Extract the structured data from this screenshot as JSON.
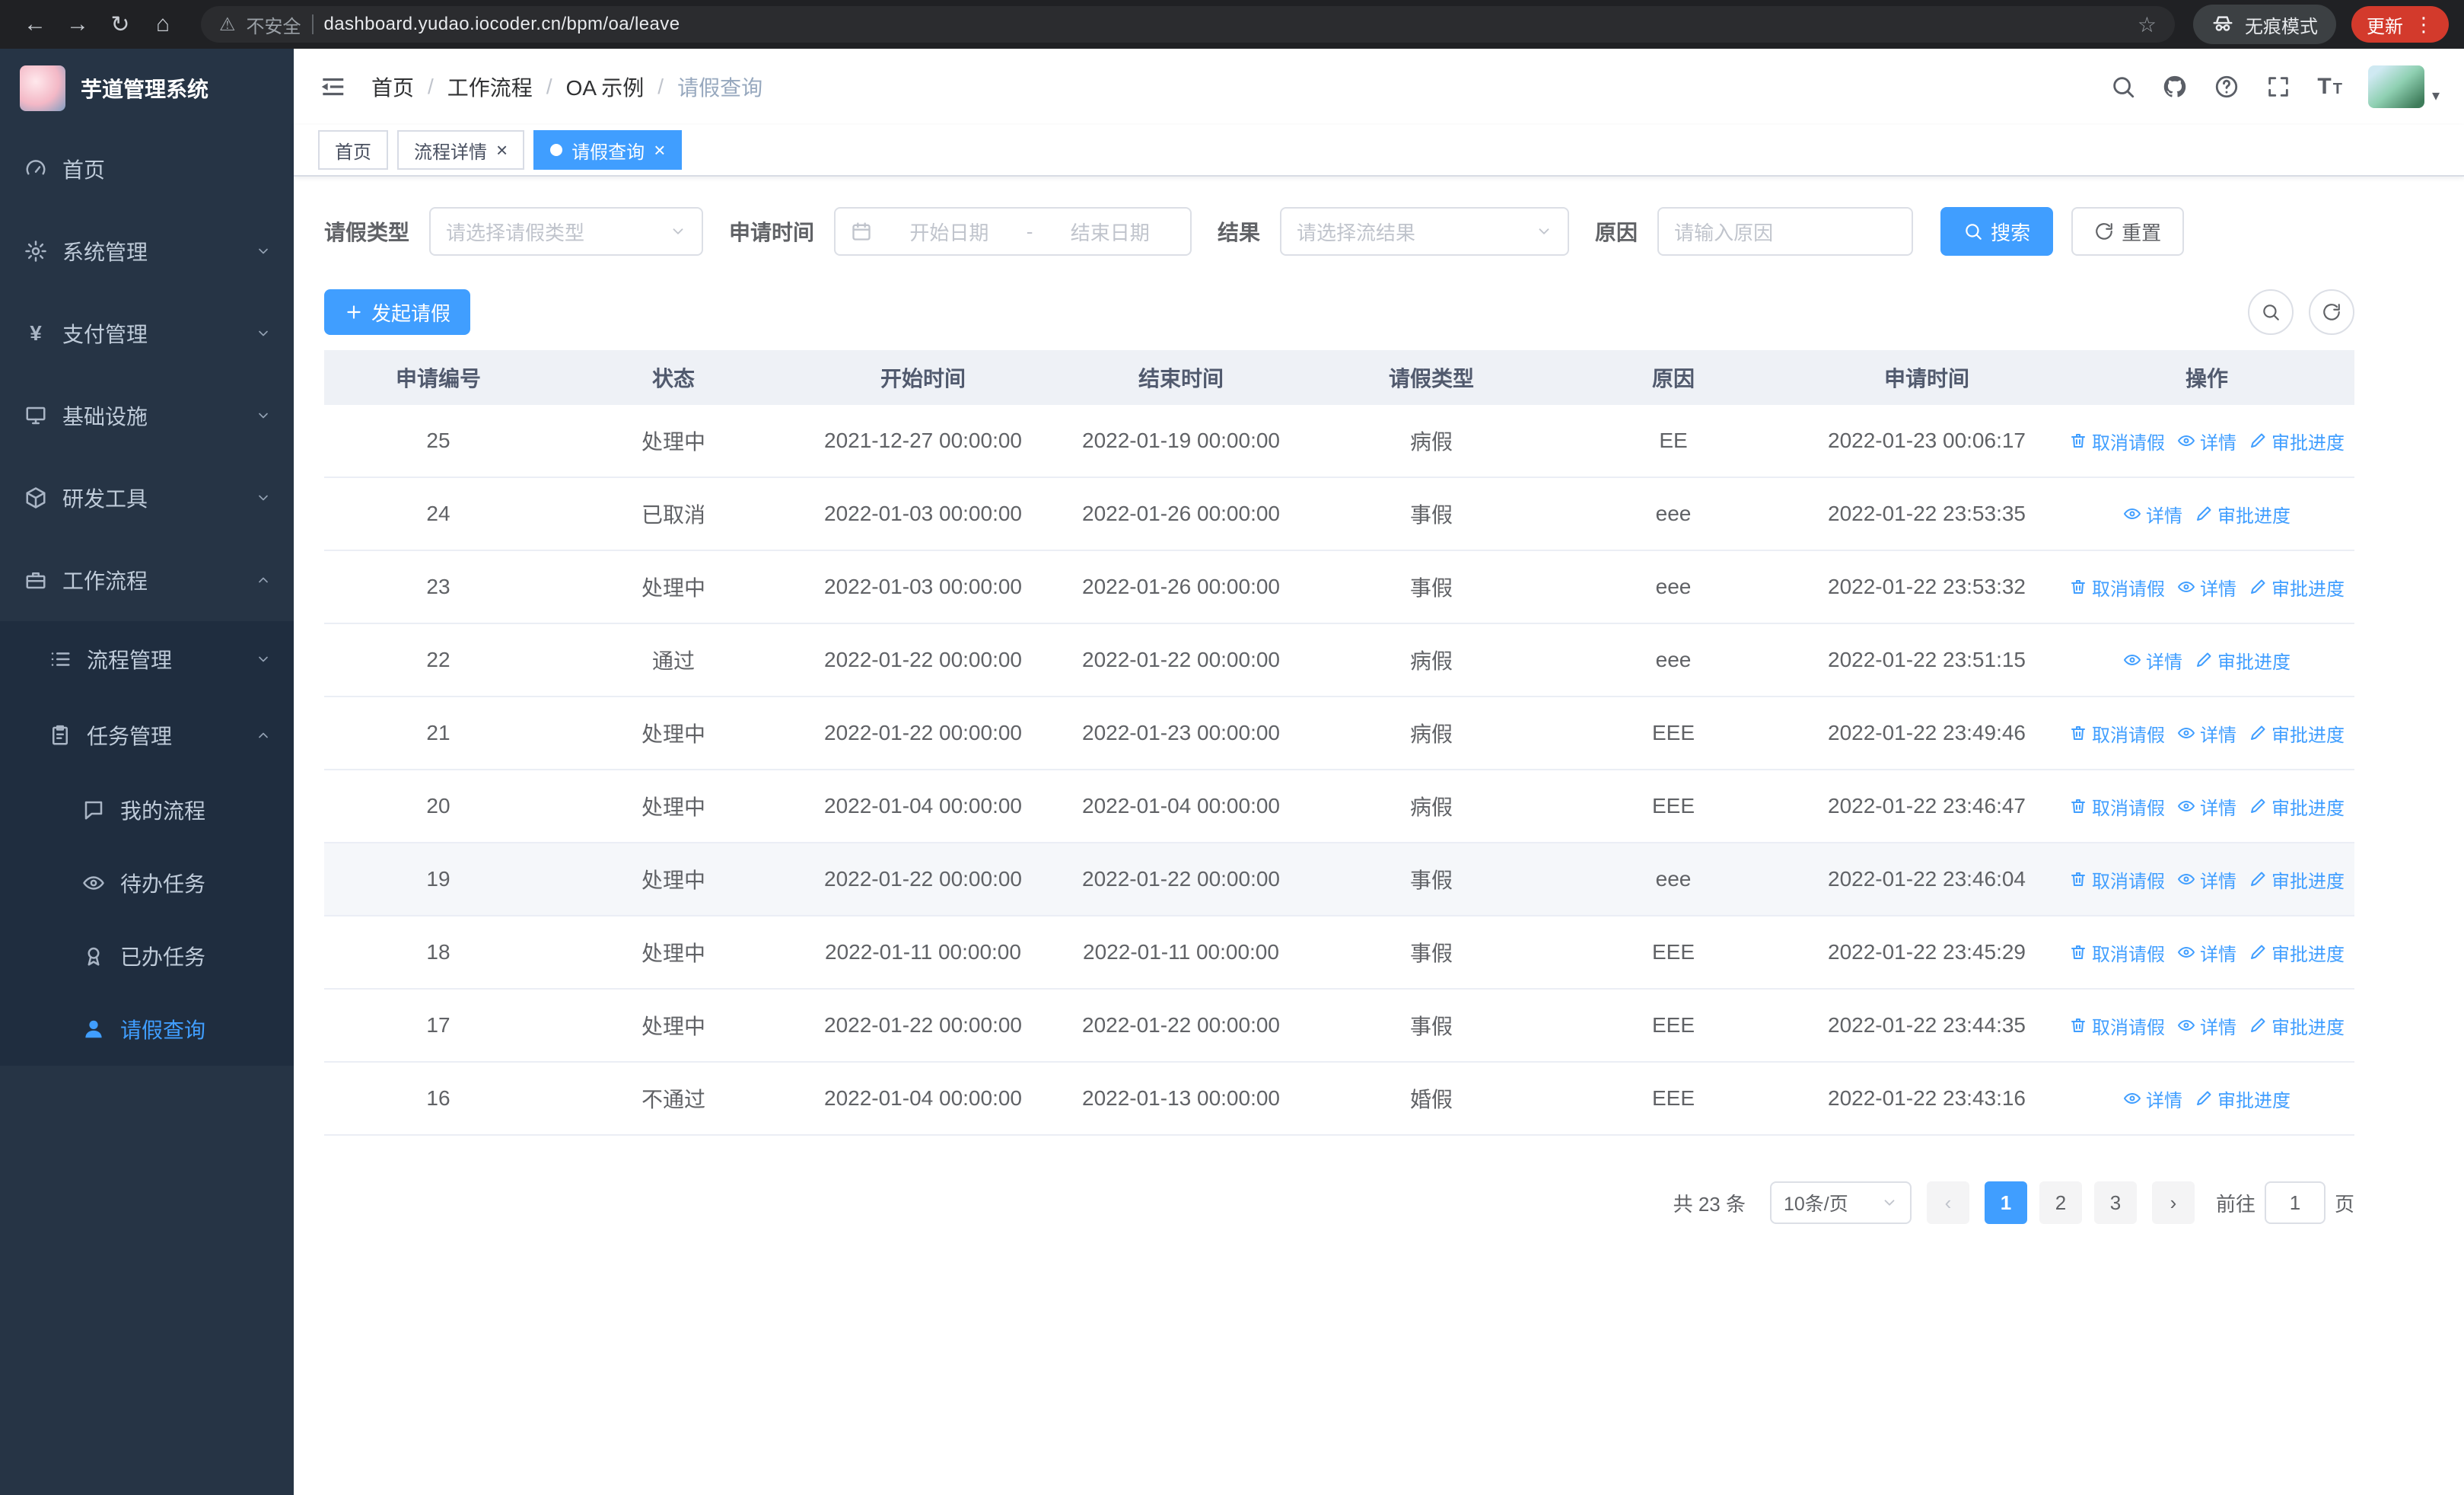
{
  "browser": {
    "security_label": "不安全",
    "url": "dashboard.yudao.iocoder.cn/bpm/oa/leave",
    "incognito_label": "无痕模式",
    "update_label": "更新"
  },
  "sidebar": {
    "logo_title": "芋道管理系统",
    "items": [
      {
        "label": "首页",
        "icon": "dashboard-icon",
        "level": 1
      },
      {
        "label": "系统管理",
        "icon": "gear-icon",
        "level": 1,
        "chevron": "down"
      },
      {
        "label": "支付管理",
        "icon": "payment-icon",
        "level": 1,
        "chevron": "down"
      },
      {
        "label": "基础设施",
        "icon": "infrastructure-icon",
        "level": 1,
        "chevron": "down"
      },
      {
        "label": "研发工具",
        "icon": "devtools-icon",
        "level": 1,
        "chevron": "down"
      },
      {
        "label": "工作流程",
        "icon": "workflow-icon",
        "level": 1,
        "chevron": "up"
      },
      {
        "label": "流程管理",
        "icon": "process-icon",
        "level": 2,
        "chevron": "down",
        "sub": true
      },
      {
        "label": "任务管理",
        "icon": "task-icon",
        "level": 2,
        "chevron": "up",
        "sub": true
      },
      {
        "label": "我的流程",
        "icon": "chat-icon",
        "level": 3,
        "sub": true
      },
      {
        "label": "待办任务",
        "icon": "eye-icon",
        "level": 3,
        "sub": true
      },
      {
        "label": "已办任务",
        "icon": "done-icon",
        "level": 3,
        "sub": true
      },
      {
        "label": "请假查询",
        "icon": "user-icon",
        "level": 3,
        "sub": true,
        "active": true
      }
    ]
  },
  "header": {
    "breadcrumb": [
      "首页",
      "工作流程",
      "OA 示例",
      "请假查询"
    ]
  },
  "tabs": [
    {
      "label": "首页"
    },
    {
      "label": "流程详情",
      "closable": true
    },
    {
      "label": "请假查询",
      "closable": true,
      "active": true
    }
  ],
  "filters": {
    "leave_type": {
      "label": "请假类型",
      "placeholder": "请选择请假类型"
    },
    "apply_time": {
      "label": "申请时间",
      "start_placeholder": "开始日期",
      "separator": "-",
      "end_placeholder": "结束日期"
    },
    "result": {
      "label": "结果",
      "placeholder": "请选择流结果"
    },
    "reason": {
      "label": "原因",
      "placeholder": "请输入原因"
    },
    "search_label": "搜索",
    "reset_label": "重置"
  },
  "toolbar": {
    "create_label": "发起请假"
  },
  "table": {
    "columns": [
      "申请编号",
      "状态",
      "开始时间",
      "结束时间",
      "请假类型",
      "原因",
      "申请时间",
      "操作"
    ],
    "action_labels": {
      "cancel": "取消请假",
      "detail": "详情",
      "progress": "审批进度"
    },
    "rows": [
      {
        "id": "25",
        "status": "处理中",
        "start": "2021-12-27 00:00:00",
        "end": "2022-01-19 00:00:00",
        "type": "病假",
        "reason": "EE",
        "apply_time": "2022-01-23 00:06:17",
        "actions": [
          "cancel",
          "detail",
          "progress"
        ]
      },
      {
        "id": "24",
        "status": "已取消",
        "start": "2022-01-03 00:00:00",
        "end": "2022-01-26 00:00:00",
        "type": "事假",
        "reason": "eee",
        "apply_time": "2022-01-22 23:53:35",
        "actions": [
          "detail",
          "progress"
        ]
      },
      {
        "id": "23",
        "status": "处理中",
        "start": "2022-01-03 00:00:00",
        "end": "2022-01-26 00:00:00",
        "type": "事假",
        "reason": "eee",
        "apply_time": "2022-01-22 23:53:32",
        "actions": [
          "cancel",
          "detail",
          "progress"
        ]
      },
      {
        "id": "22",
        "status": "通过",
        "start": "2022-01-22 00:00:00",
        "end": "2022-01-22 00:00:00",
        "type": "病假",
        "reason": "eee",
        "apply_time": "2022-01-22 23:51:15",
        "actions": [
          "detail",
          "progress"
        ]
      },
      {
        "id": "21",
        "status": "处理中",
        "start": "2022-01-22 00:00:00",
        "end": "2022-01-23 00:00:00",
        "type": "病假",
        "reason": "EEE",
        "apply_time": "2022-01-22 23:49:46",
        "actions": [
          "cancel",
          "detail",
          "progress"
        ]
      },
      {
        "id": "20",
        "status": "处理中",
        "start": "2022-01-04 00:00:00",
        "end": "2022-01-04 00:00:00",
        "type": "病假",
        "reason": "EEE",
        "apply_time": "2022-01-22 23:46:47",
        "actions": [
          "cancel",
          "detail",
          "progress"
        ]
      },
      {
        "id": "19",
        "status": "处理中",
        "start": "2022-01-22 00:00:00",
        "end": "2022-01-22 00:00:00",
        "type": "事假",
        "reason": "eee",
        "apply_time": "2022-01-22 23:46:04",
        "actions": [
          "cancel",
          "detail",
          "progress"
        ],
        "highlighted": true
      },
      {
        "id": "18",
        "status": "处理中",
        "start": "2022-01-11 00:00:00",
        "end": "2022-01-11 00:00:00",
        "type": "事假",
        "reason": "EEE",
        "apply_time": "2022-01-22 23:45:29",
        "actions": [
          "cancel",
          "detail",
          "progress"
        ]
      },
      {
        "id": "17",
        "status": "处理中",
        "start": "2022-01-22 00:00:00",
        "end": "2022-01-22 00:00:00",
        "type": "事假",
        "reason": "EEE",
        "apply_time": "2022-01-22 23:44:35",
        "actions": [
          "cancel",
          "detail",
          "progress"
        ]
      },
      {
        "id": "16",
        "status": "不通过",
        "start": "2022-01-04 00:00:00",
        "end": "2022-01-13 00:00:00",
        "type": "婚假",
        "reason": "EEE",
        "apply_time": "2022-01-22 23:43:16",
        "actions": [
          "detail",
          "progress"
        ]
      }
    ]
  },
  "pagination": {
    "total_label": "共 23 条",
    "page_size_label": "10条/页",
    "pages": [
      "1",
      "2",
      "3"
    ],
    "active_page": "1",
    "goto_prefix": "前往",
    "goto_value": "1",
    "goto_suffix": "页"
  },
  "colors": {
    "accent": "#409eff",
    "sidebar_bg": "#263445",
    "update_badge": "#d33a2c"
  }
}
